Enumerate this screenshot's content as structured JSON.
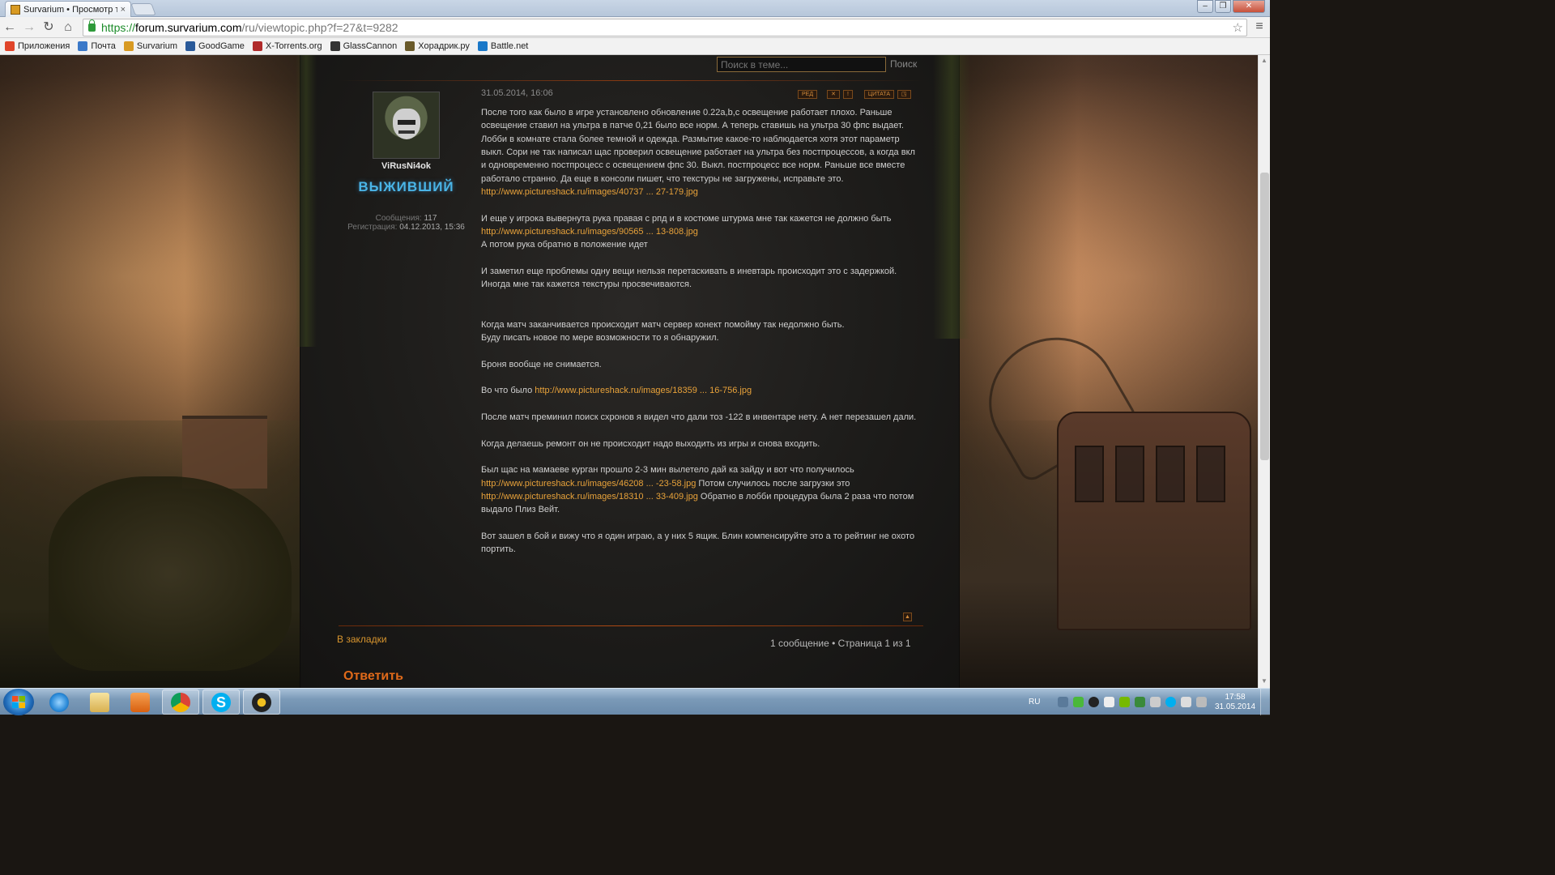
{
  "browser": {
    "tab_title": "Survarium • Просмотр те",
    "tab_close": "×",
    "url_scheme": "https://",
    "url_host": "forum.survarium.com",
    "url_path": "/ru/viewtopic.php?f=27&t=9282",
    "window_buttons": [
      "–",
      "❐",
      "✕"
    ]
  },
  "bookmarks": [
    {
      "label": "Приложения",
      "icon": "apps-grid-icon",
      "color": "#e0452a"
    },
    {
      "label": "Почта",
      "icon": "mail-icon",
      "color": "#3a78c8"
    },
    {
      "label": "Survarium",
      "icon": "survarium-icon",
      "color": "#d89a22"
    },
    {
      "label": "GoodGame",
      "icon": "goodgame-icon",
      "color": "#2a5a9a"
    },
    {
      "label": "X-Torrents.org",
      "icon": "xtorrents-icon",
      "color": "#b02a2a"
    },
    {
      "label": "GlassCannon",
      "icon": "glasscannon-icon",
      "color": "#333333"
    },
    {
      "label": "Хорадрик.ру",
      "icon": "horadric-icon",
      "color": "#6a5a2a"
    },
    {
      "label": "Battle.net",
      "icon": "battlenet-icon",
      "color": "#1a78c8"
    }
  ],
  "forum": {
    "search_placeholder": "Поиск в теме...",
    "search_button": "Поиск",
    "post": {
      "date": "31.05.2014, 16:06",
      "buttons": [
        "РЕД",
        "✕",
        "!",
        "ЦИТАТА",
        "◳"
      ],
      "author": "ViRusNi4ok",
      "rank": "ВЫЖИВШИЙ",
      "posts_label": "Сообщения:",
      "posts_value": "117",
      "reg_label": "Регистрация:",
      "reg_value": "04.12.2013, 15:36",
      "body": [
        "После того как было в игре установлено обновление 0.22a,b,c освещение работает плохо. Раньше освещение ставил на ультра в патче 0,21 было все норм. А теперь ставишь на ультра 30 фпс выдает. Лобби в комнате стала более темной и одежда. Размытие какое-то наблюдается хотя этот параметр выкл. Сори не так написал щас проверил освещение работает на ультра без постпроцессов, а когда вкл и одновременно постпроцесс с освещением фпс 30. Выкл. постпроцесс все норм. Раньше все вместе работало странно. Да еще в консоли пишет, что текстуры не загружены, исправьте это.",
        "http://www.pictureshack.ru/images/40737 ... 27-179.jpg",
        "",
        "И еще у игрока вывернута рука правая с рпд и в костюме штурма мне так кажется не должно быть",
        "http://www.pictureshack.ru/images/90565 ... 13-808.jpg",
        "А потом рука обратно в положение идет",
        "",
        "И заметил еще проблемы одну вещи нельзя перетаскивать в иневтарь происходит это с задержкой.",
        "Иногда мне так кажется текстуры просвечиваются.",
        "",
        "",
        "Когда матч заканчивается происходит матч сервер конект помойму так недолжно быть.",
        "Буду писать новое по мере возможности то я обнаружил.",
        "",
        "Броня вообще не снимается.",
        "",
        "Во что было",
        "http://www.pictureshack.ru/images/18359 ... 16-756.jpg",
        "",
        "После матч преминил поиск схронов я видел что дали тоз -122 в инвентаре нету. А нет перезашел дали.",
        "",
        "Когда делаешь ремонт он не происходит надо выходить из игры и снова входить.",
        "",
        "Был щас на мамаеве курган прошло 2-3 мин вылетело дай ка зайду и вот что получилось",
        "http://www.pictureshack.ru/images/46208 ... -23-58.jpg",
        "Потом случилось после загрузки это",
        "http://www.pictureshack.ru/images/18310 ... 33-409.jpg",
        "Обратно в лобби процедура была 2 раза что потом выдало Плиз Вейт.",
        "",
        "Вот зашел в бой и вижу что я один играю, а у них 5 ящик. Блин компенсируйте это а то рейтинг не охото портить."
      ]
    },
    "back_to_top": "▲",
    "bookmark_link": "В закладки",
    "pagination": "1 сообщение • Страница 1 из 1",
    "reply_button": "Ответить"
  },
  "taskbar": {
    "items": [
      {
        "name": "ie-icon",
        "color": "#2a8ad8"
      },
      {
        "name": "explorer-icon",
        "color": "#e8c060"
      },
      {
        "name": "media-player-icon",
        "color": "#e87a20"
      },
      {
        "name": "chrome-icon",
        "color": "#3aa84a"
      },
      {
        "name": "skype-icon",
        "color": "#00aff0"
      },
      {
        "name": "survarium-game-icon",
        "color": "#222222"
      }
    ],
    "lang": "RU",
    "time": "17:58",
    "date": "31.05.2014"
  }
}
